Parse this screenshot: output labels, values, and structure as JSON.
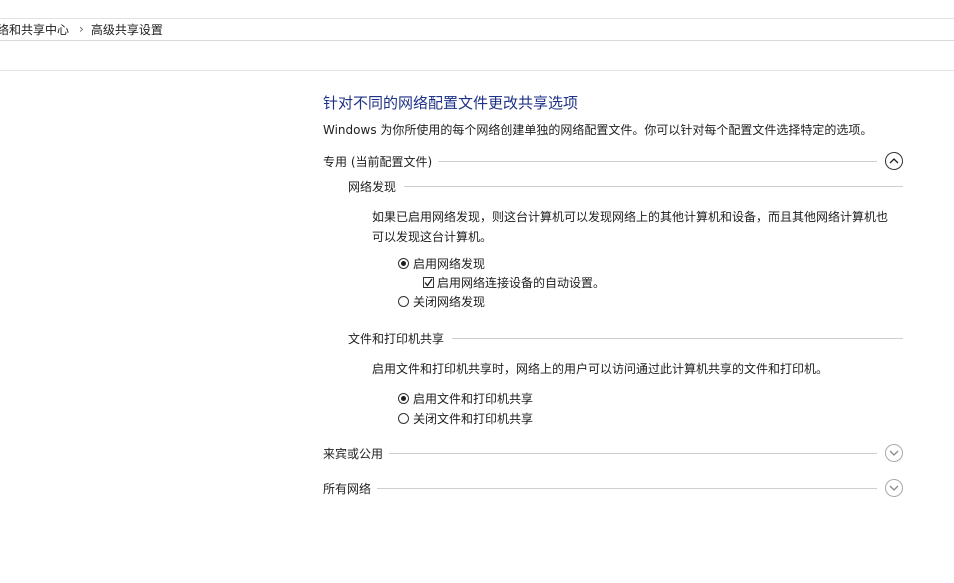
{
  "breadcrumb": {
    "parent": "络和共享中心",
    "separator": "›",
    "current": "高级共享设置"
  },
  "main": {
    "title": "针对不同的网络配置文件更改共享选项",
    "description": "Windows 为你所使用的每个网络创建单独的网络配置文件。你可以针对每个配置文件选择特定的选项。"
  },
  "profiles": {
    "private": {
      "label": "专用 (当前配置文件)",
      "expanded": true,
      "network_discovery": {
        "title": "网络发现",
        "description": "如果已启用网络发现，则这台计算机可以发现网络上的其他计算机和设备，而且其他网络计算机也可以发现这台计算机。",
        "option_on": "启用网络发现",
        "auto_setup": "启用网络连接设备的自动设置。",
        "auto_setup_checked": true,
        "option_off": "关闭网络发现",
        "selected": "on"
      },
      "file_printer_sharing": {
        "title": "文件和打印机共享",
        "description": "启用文件和打印机共享时，网络上的用户可以访问通过此计算机共享的文件和打印机。",
        "option_on": "启用文件和打印机共享",
        "option_off": "关闭文件和打印机共享",
        "selected": "on"
      }
    },
    "guest_public": {
      "label": "来宾或公用",
      "expanded": false
    },
    "all_networks": {
      "label": "所有网络",
      "expanded": false
    }
  },
  "colors": {
    "title": "#1e3287",
    "divider": "#cfcfcf"
  }
}
